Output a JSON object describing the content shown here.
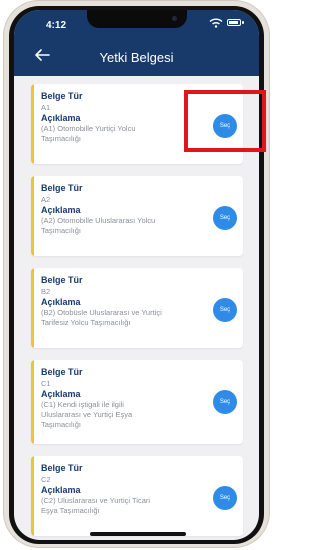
{
  "status": {
    "time": "4:12"
  },
  "header": {
    "title": "Yetki Belgesi"
  },
  "labels": {
    "doc_type": "Belge Tür",
    "description": "Açıklama",
    "select": "Seç"
  },
  "cards": [
    {
      "code": "A1",
      "desc_line1": "(A1) Otomobille Yurtiçi Yolcu",
      "desc_line2": "Taşımacılığı",
      "desc_line3": ""
    },
    {
      "code": "A2",
      "desc_line1": "(A2) Otomobille Uluslararası Yolcu",
      "desc_line2": "Taşımacılığı",
      "desc_line3": ""
    },
    {
      "code": "B2",
      "desc_line1": "(B2) Otobüsle Uluslararası ve Yurtiçi",
      "desc_line2": "Tarifesiz Yolcu Taşımacılığı",
      "desc_line3": ""
    },
    {
      "code": "C1",
      "desc_line1": "(C1) Kendi iştigali ile ilgili",
      "desc_line2": "Uluslararası ve Yurtiçi Eşya",
      "desc_line3": "Taşımacılığı"
    },
    {
      "code": "C2",
      "desc_line1": "(C2) Uluslararası ve Yurtiçi Ticari",
      "desc_line2": "Eşya Taşımacılığı",
      "desc_line3": ""
    }
  ],
  "colors": {
    "header": "#173a6b",
    "accent": "#f3c233",
    "button": "#2e8be7",
    "highlight": "#e1161b"
  }
}
